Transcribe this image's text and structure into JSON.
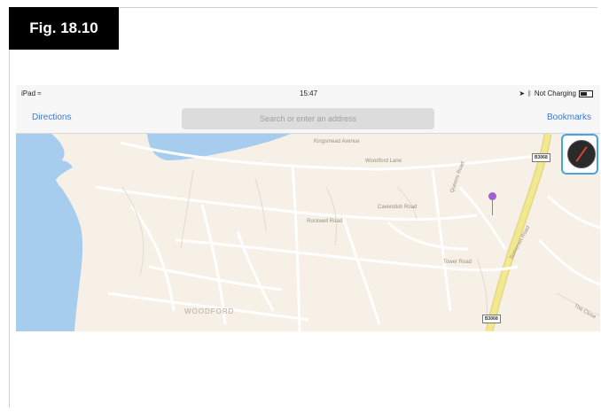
{
  "figure": {
    "label": "Fig. 18.10"
  },
  "status_bar": {
    "device": "iPad",
    "time": "15:47",
    "battery_text": "Not Charging"
  },
  "nav": {
    "directions_label": "Directions",
    "search_placeholder": "Search or enter an address",
    "bookmarks_label": "Bookmarks"
  },
  "map": {
    "streets": [
      "Kingsmead Avenue",
      "Woodford Lane",
      "Cavendish Road",
      "Rockwell Road",
      "Somerset Road",
      "Queens Road",
      "Tower Road",
      "The Close"
    ],
    "road_badges": [
      "B3068",
      "B3068"
    ],
    "area_label": "WOODFORD"
  },
  "colors": {
    "accent": "#3a7bd5",
    "water": "#a7cdee",
    "land": "#f6f0e6",
    "main_road": "#f2e88f",
    "pin": "#a25fd1"
  }
}
